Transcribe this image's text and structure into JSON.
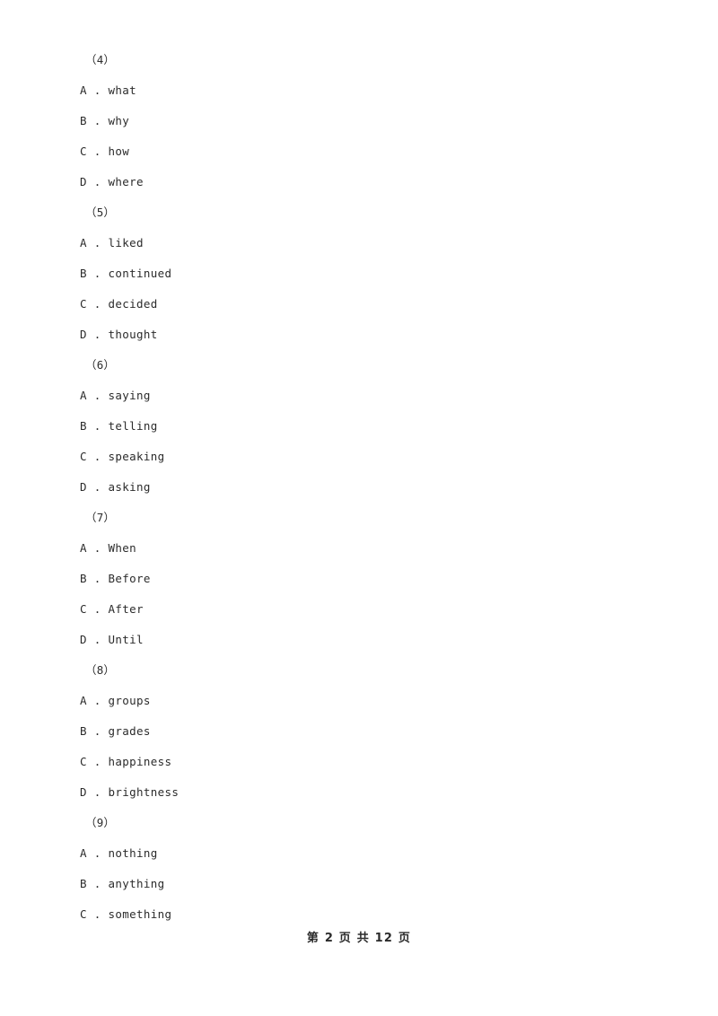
{
  "document": {
    "page_label": "第 2 页 共 12 页",
    "page_number": "2",
    "total_pages": "12",
    "text_color": "#2b2b2b",
    "background_color": "#ffffff"
  },
  "questions": [
    {
      "number": "（4）",
      "options": [
        {
          "letter": "A",
          "sep": " . ",
          "text": "what"
        },
        {
          "letter": "B",
          "sep": " . ",
          "text": "why"
        },
        {
          "letter": "C",
          "sep": " . ",
          "text": "how"
        },
        {
          "letter": "D",
          "sep": " . ",
          "text": "where"
        }
      ]
    },
    {
      "number": "（5）",
      "options": [
        {
          "letter": "A",
          "sep": " . ",
          "text": "liked"
        },
        {
          "letter": "B",
          "sep": " . ",
          "text": "continued"
        },
        {
          "letter": "C",
          "sep": " . ",
          "text": "decided"
        },
        {
          "letter": "D",
          "sep": " . ",
          "text": "thought"
        }
      ]
    },
    {
      "number": "（6）",
      "options": [
        {
          "letter": "A",
          "sep": " . ",
          "text": "saying"
        },
        {
          "letter": "B",
          "sep": " . ",
          "text": "telling"
        },
        {
          "letter": "C",
          "sep": " . ",
          "text": "speaking"
        },
        {
          "letter": "D",
          "sep": " . ",
          "text": "asking"
        }
      ]
    },
    {
      "number": "（7）",
      "options": [
        {
          "letter": "A",
          "sep": " . ",
          "text": "When"
        },
        {
          "letter": "B",
          "sep": " . ",
          "text": "Before"
        },
        {
          "letter": "C",
          "sep": " . ",
          "text": "After"
        },
        {
          "letter": "D",
          "sep": " . ",
          "text": "Until"
        }
      ]
    },
    {
      "number": "（8）",
      "options": [
        {
          "letter": "A",
          "sep": " . ",
          "text": "groups"
        },
        {
          "letter": "B",
          "sep": " . ",
          "text": "grades"
        },
        {
          "letter": "C",
          "sep": " . ",
          "text": "happiness"
        },
        {
          "letter": "D",
          "sep": " . ",
          "text": "brightness"
        }
      ]
    },
    {
      "number": "（9）",
      "options": [
        {
          "letter": "A",
          "sep": " . ",
          "text": "nothing"
        },
        {
          "letter": "B",
          "sep": " . ",
          "text": "anything"
        },
        {
          "letter": "C",
          "sep": " . ",
          "text": "something"
        }
      ]
    }
  ]
}
